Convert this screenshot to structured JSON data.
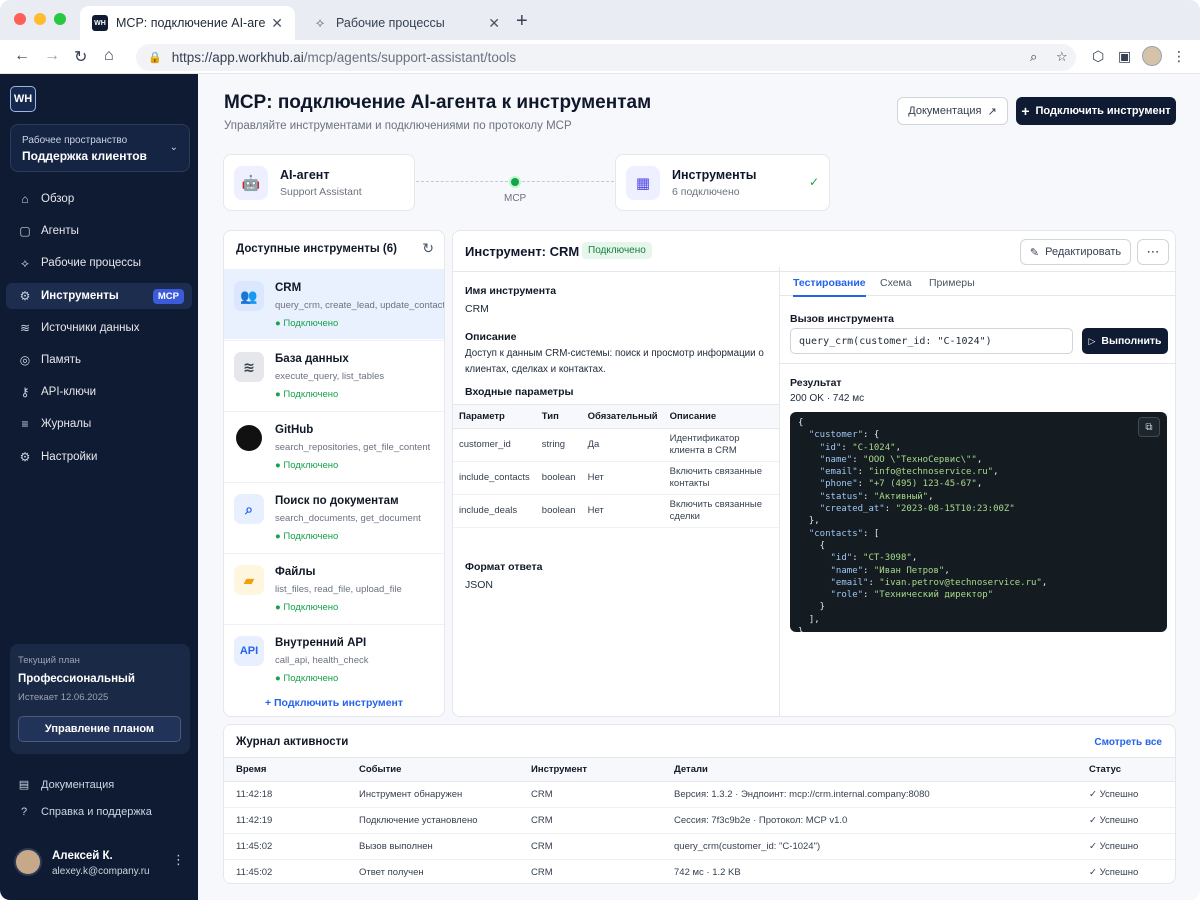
{
  "browser": {
    "tabs": [
      {
        "title": "MCP: подключение AI-агента к",
        "favicon": "WH"
      },
      {
        "title": "Рабочие процессы",
        "favicon": "workflow-icon"
      }
    ],
    "url_host": "https://app.workhub.ai",
    "url_path": "/mcp/agents/support-assistant/tools"
  },
  "sidebar": {
    "logo": "WH",
    "workspace_label": "Рабочее пространство",
    "workspace_name": "Поддержка клиентов",
    "items": [
      {
        "label": "Обзор",
        "icon": "home-icon"
      },
      {
        "label": "Агенты",
        "icon": "agents-icon"
      },
      {
        "label": "Рабочие процессы",
        "icon": "workflow-icon"
      },
      {
        "label": "Инструменты",
        "icon": "tools-icon",
        "badge": "MCP"
      },
      {
        "label": "Источники данных",
        "icon": "database-icon"
      },
      {
        "label": "Память",
        "icon": "memory-icon"
      },
      {
        "label": "API-ключи",
        "icon": "key-icon"
      },
      {
        "label": "Журналы",
        "icon": "logs-icon"
      },
      {
        "label": "Настройки",
        "icon": "gear-icon"
      }
    ],
    "plan": {
      "label": "Текущий план",
      "name": "Профессиональный",
      "expires": "Истекает 12.06.2025",
      "button": "Управление планом"
    },
    "footer": [
      {
        "label": "Документация",
        "icon": "book-icon"
      },
      {
        "label": "Справка и поддержка",
        "icon": "help-icon"
      }
    ],
    "user": {
      "name": "Алексей К.",
      "email": "alexey.k@company.ru"
    }
  },
  "header": {
    "title": "MCP: подключение AI-агента к инструментам",
    "subtitle": "Управляйте инструментами и подключениями по протоколу MCP",
    "docs_button": "Документация",
    "add_button": "Подключить инструмент"
  },
  "flow": {
    "agent_title": "AI-агент",
    "agent_name": "Support Assistant",
    "link_label": "MCP",
    "tools_title": "Инструменты",
    "tools_count": "6 подключено"
  },
  "tools": {
    "heading": "Доступные инструменты (6)",
    "add_link": "+ Подключить инструмент",
    "items": [
      {
        "name": "CRM",
        "functions": "query_crm, create_lead, update_contact",
        "status": "Подключено"
      },
      {
        "name": "База данных",
        "functions": "execute_query, list_tables",
        "status": "Подключено"
      },
      {
        "name": "GitHub",
        "functions": "search_repositories, get_file_content",
        "status": "Подключено"
      },
      {
        "name": "Поиск по документам",
        "functions": "search_documents, get_document",
        "status": "Подключено"
      },
      {
        "name": "Файлы",
        "functions": "list_files, read_file, upload_file",
        "status": "Подключено"
      },
      {
        "name": "Внутренний API",
        "functions": "call_api, health_check",
        "status": "Подключено"
      }
    ]
  },
  "detail": {
    "title": "Инструмент: CRM",
    "status": "Подключено",
    "edit_button": "Редактировать",
    "name_label": "Имя инструмента",
    "name_value": "CRM",
    "desc_label": "Описание",
    "desc_value": "Доступ к данным CRM-системы: поиск и просмотр информации о клиентах, сделках и контактах.",
    "params_label": "Входные параметры",
    "params_headers": [
      "Параметр",
      "Тип",
      "Обязательный",
      "Описание"
    ],
    "params": [
      [
        "customer_id",
        "string",
        "Да",
        "Идентификатор клиента в CRM"
      ],
      [
        "include_contacts",
        "boolean",
        "Нет",
        "Включить связанные контакты"
      ],
      [
        "include_deals",
        "boolean",
        "Нет",
        "Включить связанные сделки"
      ]
    ],
    "format_label": "Формат ответа",
    "format_value": "JSON",
    "tabs": [
      "Тестирование",
      "Схема",
      "Примеры"
    ],
    "call_label": "Вызов инструмента",
    "call_value": "query_crm(customer_id: \"C-1024\")",
    "run_button": "Выполнить",
    "result_label": "Результат",
    "result_meta": "200 OK · 742 мс"
  },
  "log": {
    "heading": "Журнал активности",
    "view_all": "Смотреть все",
    "headers": [
      "Время",
      "Событие",
      "Инструмент",
      "Детали",
      "Статус"
    ],
    "rows": [
      [
        "11:42:18",
        "Инструмент обнаружен",
        "CRM",
        "Версия: 1.3.2 · Эндпоинт: mcp://crm.internal.company:8080",
        "Успешно"
      ],
      [
        "11:42:19",
        "Подключение установлено",
        "CRM",
        "Сессия: 7f3c9b2e · Протокол: MCP v1.0",
        "Успешно"
      ],
      [
        "11:45:02",
        "Вызов выполнен",
        "CRM",
        "query_crm(customer_id: \"C-1024\")",
        "Успешно"
      ],
      [
        "11:45:02",
        "Ответ получен",
        "CRM",
        "742 мс · 1.2 KB",
        "Успешно"
      ]
    ]
  }
}
